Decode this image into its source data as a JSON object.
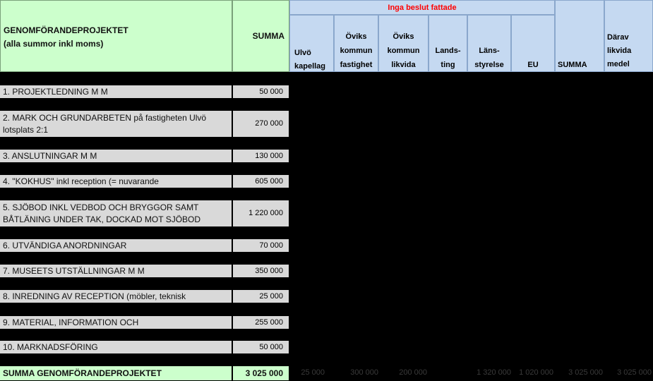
{
  "header": {
    "title_line1": "GENOMFÖRANDEPROJEKTET",
    "title_line2": "(alla summor inkl moms)",
    "summa": "SUMMA",
    "group_note": "Inga beslut fattade",
    "columns": [
      {
        "line1": "",
        "line2": "",
        "line3": "Ulvö kapellag"
      },
      {
        "line1": "Öviks",
        "line2": "kommun",
        "line3": "fastighet"
      },
      {
        "line1": "Öviks",
        "line2": "kommun",
        "line3": "likvida"
      },
      {
        "line1": "",
        "line2": "Lands-",
        "line3": "ting"
      },
      {
        "line1": "",
        "line2": "Läns-",
        "line3": "styrelse"
      },
      {
        "line1": "",
        "line2": "",
        "line3": "EU"
      }
    ],
    "summa2": "SUMMA",
    "darav": [
      "Därav",
      "likvida",
      "medel"
    ],
    "colors": {
      "note": "#ff0000"
    }
  },
  "rows": [
    {
      "label": "1. PROJEKTLEDNING M M",
      "amount": "50 000"
    },
    {
      "label": "2. MARK OCH GRUNDARBETEN på fastigheten Ulvö lotsplats 2:1",
      "amount": "270 000"
    },
    {
      "label": "3. ANSLUTNINGAR M M",
      "amount": "130 000"
    },
    {
      "label": "4. \"KOKHUS\" inkl reception (= nuvarande",
      "amount": "605 000"
    },
    {
      "label": "5. SJÖBOD INKL VEDBOD OCH BRYGGOR SAMT BÅTLÄNING UNDER TAK, DOCKAD MOT SJÖBOD",
      "amount": "1 220 000"
    },
    {
      "label": "6. UTVÄNDIGA ANORDNINGAR",
      "amount": "70 000"
    },
    {
      "label": "7. MUSEETS UTSTÄLLNINGAR M M",
      "amount": "350 000"
    },
    {
      "label": "8. INREDNING AV RECEPTION (möbler, teknisk",
      "amount": "25 000"
    },
    {
      "label": "9. MATERIAL, INFORMATION OCH",
      "amount": "255 000"
    },
    {
      "label": "10. MARKNADSFÖRING",
      "amount": "50 000"
    }
  ],
  "total": {
    "label": "SUMMA GENOMFÖRANDEPROJEKTET",
    "amount": "3 025 000",
    "cols": [
      "25 000",
      "300 000",
      "200 000",
      "",
      "1 320 000",
      "1 020 000",
      "3 025 000",
      "3 025 000"
    ]
  }
}
